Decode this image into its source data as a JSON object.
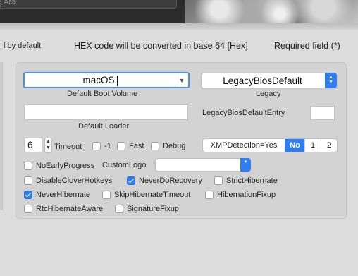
{
  "search": {
    "placeholder": "Ara"
  },
  "header": {
    "default_fragment": "l by default",
    "hex_notice": "HEX code will be converted in base 64 [Hex]",
    "required_notice": "Required field (*)"
  },
  "boot": {
    "default_volume_value": "macOS",
    "default_volume_label": "Default Boot Volume",
    "legacy_value": "LegacyBiosDefault",
    "legacy_label": "Legacy",
    "default_loader_value": "",
    "default_loader_label": "Default Loader",
    "legacy_entry_label": "LegacyBiosDefaultEntry",
    "legacy_entry_value": "",
    "timeout_value": "6",
    "timeout_label": "Timeout"
  },
  "options": {
    "minus_one": {
      "label": "-1",
      "checked": false
    },
    "fast": {
      "label": "Fast",
      "checked": false
    },
    "debug": {
      "label": "Debug",
      "checked": false
    },
    "no_early_progress": {
      "label": "NoEarlyProgress",
      "checked": false
    },
    "custom_logo_label": "CustomLogo",
    "custom_logo_value": "",
    "disable_clover_hotkeys": {
      "label": "DisableCloverHotkeys",
      "checked": false
    },
    "never_do_recovery": {
      "label": "NeverDoRecovery",
      "checked": true
    },
    "strict_hibernate": {
      "label": "StrictHibernate",
      "checked": false
    },
    "never_hibernate": {
      "label": "NeverHibernate",
      "checked": true
    },
    "skip_hibernate_timeout": {
      "label": "SkipHibernateTimeout",
      "checked": false
    },
    "hibernation_fixup": {
      "label": "HibernationFixup",
      "checked": false
    },
    "rtc_hibernate_aware": {
      "label": "RtcHibernateAware",
      "checked": false
    },
    "signature_fixup": {
      "label": "SignatureFixup",
      "checked": false
    }
  },
  "xmp": {
    "segments": [
      "XMPDetection=Yes",
      "No",
      "1",
      "2"
    ],
    "selected": "No"
  },
  "colors": {
    "accent": "#2f7df3",
    "panel": "#d3d3d3",
    "background": "#dcdcdc"
  }
}
